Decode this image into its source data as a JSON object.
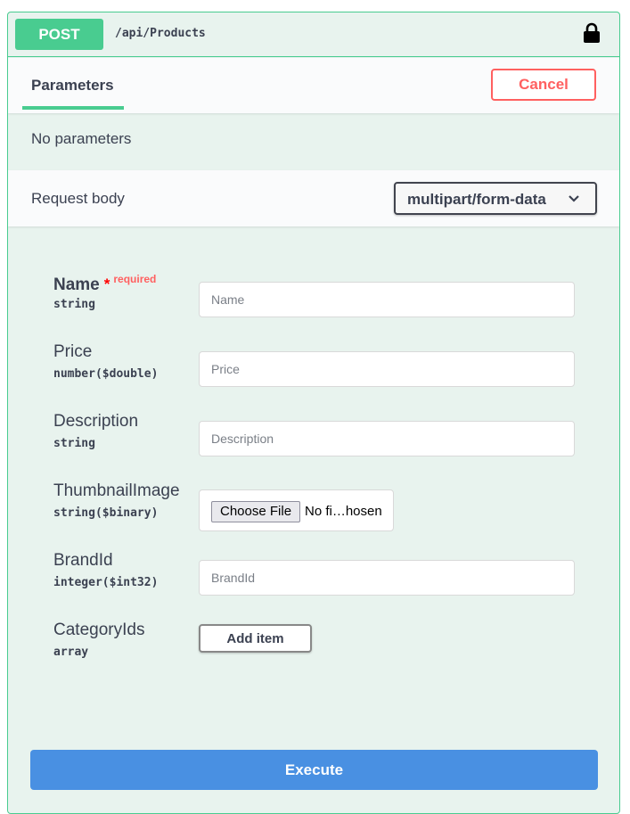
{
  "operation": {
    "method": "POST",
    "path": "/api/Products",
    "method_color": "#49cc90",
    "lock_icon": "lock-icon"
  },
  "parameters": {
    "tab_label": "Parameters",
    "cancel_label": "Cancel",
    "empty_text": "No parameters"
  },
  "request_body": {
    "label": "Request body",
    "content_type": "multipart/form-data",
    "fields": [
      {
        "name": "Name",
        "required_star": "*",
        "required_text": "required",
        "type": "string",
        "placeholder": "Name"
      },
      {
        "name": "Price",
        "type": "number($double)",
        "placeholder": "Price"
      },
      {
        "name": "Description",
        "type": "string",
        "placeholder": "Description"
      },
      {
        "name": "ThumbnailImage",
        "type": "string($binary)",
        "file_button": "Choose File",
        "file_status": "No fi…hosen"
      },
      {
        "name": "BrandId",
        "type": "integer($int32)",
        "placeholder": "BrandId"
      },
      {
        "name": "CategoryIds",
        "type": "array",
        "add_item_label": "Add item"
      }
    ]
  },
  "execute_label": "Execute",
  "colors": {
    "accent_green": "#49cc90",
    "cancel_red": "#ff6060",
    "execute_blue": "#4990e2",
    "panel_bg": "#e8f3ee"
  }
}
